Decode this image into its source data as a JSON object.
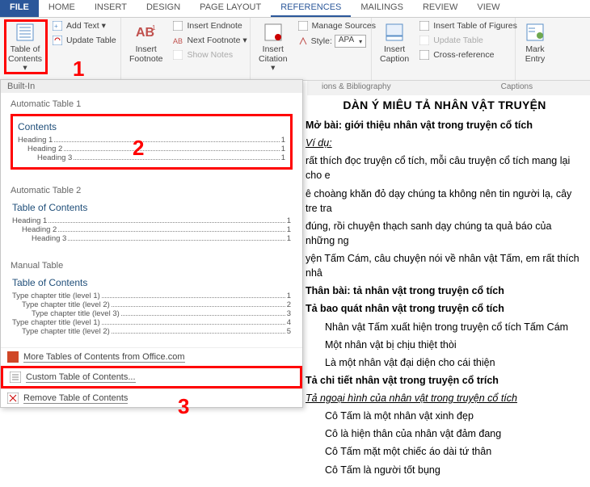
{
  "tabs": {
    "file": "FILE",
    "home": "HOME",
    "insert": "INSERT",
    "design": "DESIGN",
    "page_layout": "PAGE LAYOUT",
    "references": "REFERENCES",
    "mailings": "MAILINGS",
    "review": "REVIEW",
    "view": "VIEW"
  },
  "ribbon": {
    "toc": {
      "label": "Table of\nContents ▾"
    },
    "add_text": "Add Text ▾",
    "update_table": "Update Table",
    "insert_footnote": "Insert\nFootnote",
    "insert_endnote": "Insert Endnote",
    "next_footnote": "Next Footnote ▾",
    "show_notes": "Show Notes",
    "insert_citation": "Insert\nCitation ▾",
    "manage_sources": "Manage Sources",
    "style": "Style:",
    "style_value": "APA",
    "insert_caption": "Insert\nCaption",
    "insert_tof": "Insert Table of Figures",
    "update_table2": "Update Table",
    "cross_reference": "Cross-reference",
    "mark_entry": "Mark\nEntry",
    "group_citations": "ions & Bibliography",
    "group_captions": "Captions"
  },
  "dropdown": {
    "builtin": "Built-In",
    "auto1": "Automatic Table 1",
    "auto1_title": "Contents",
    "auto2": "Automatic Table 2",
    "auto2_title": "Table of Contents",
    "manual": "Manual Table",
    "manual_title": "Table of Contents",
    "heading1": "Heading 1",
    "heading2": "Heading 2",
    "heading3": "Heading 3",
    "type1": "Type chapter title (level 1)",
    "type2": "Type chapter title (level 2)",
    "type3": "Type chapter title (level 3)",
    "page1": "1",
    "page2": "2",
    "page3": "3",
    "page4": "4",
    "page5": "5",
    "more_office": "More Tables of Contents from Office.com",
    "custom": "Custom Table of Contents...",
    "remove": "Remove Table of Contents"
  },
  "doc": {
    "title": "DÀN Ý MIÊU TẢ NHÂN VẬT TRUYỆN",
    "h_intro": "Mở bài: giới thiệu nhân vật trong truyện cổ tích",
    "vidu": "Ví dụ:",
    "p1": "rất thích đọc truyện cổ tích, mỗi câu truyện cổ tích mang lại cho e",
    "p2": "ê choàng khăn đỏ dạy chúng ta không nên tin người lạ, cây tre tra",
    "p3": "đúng, rồi chuyện thạch sanh dạy chúng ta quả báo của những ng",
    "p4": "yện Tấm Cám, câu chuyện nói về nhân vật Tấm, em rất thích nhâ",
    "h_body": "Thân bài: tả nhân vật trong truyện cổ tích",
    "h_bao": "Tả bao quát nhân vật trong truyện cổ tích",
    "b1": "Nhân vật Tấm xuất hiện trong truyện cổ tích Tấm Cám",
    "b2": "Một nhân vật bị chịu thiệt thòi",
    "b3": "Là một nhân vật đại diện cho cái thiện",
    "h_chi": "Tả chi tiết nhân vật trong truyện cổ trích",
    "h_ng": "Tả ngoại hình của nhân vật trong truyện cổ tích",
    "c1": "Cô Tấm là một nhân vật xinh đẹp",
    "c2": "Cô là hiện thân của nhân vật đảm đang",
    "c3": "Cô Tấm mặt một chiếc áo dài tứ thân",
    "c4": "Cô Tấm là người tốt bụng"
  },
  "annotations": {
    "a1": "1",
    "a2": "2",
    "a3": "3"
  }
}
